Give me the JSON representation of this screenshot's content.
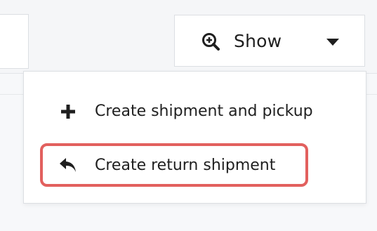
{
  "toolbar": {
    "show_button": {
      "label": "Show",
      "icon": "zoom-in-icon",
      "dropdown_icon": "caret-down-icon"
    }
  },
  "dropdown_menu": {
    "items": [
      {
        "label": "Create shipment and pickup",
        "icon": "plus-icon"
      },
      {
        "label": "Create return shipment",
        "icon": "reply-arrow-icon",
        "highlighted": true
      }
    ]
  },
  "colors": {
    "highlight": "#e2605e",
    "text": "#1f1f1f",
    "border": "#dcdfe3",
    "toolbar_background": "#f5f6f8"
  }
}
